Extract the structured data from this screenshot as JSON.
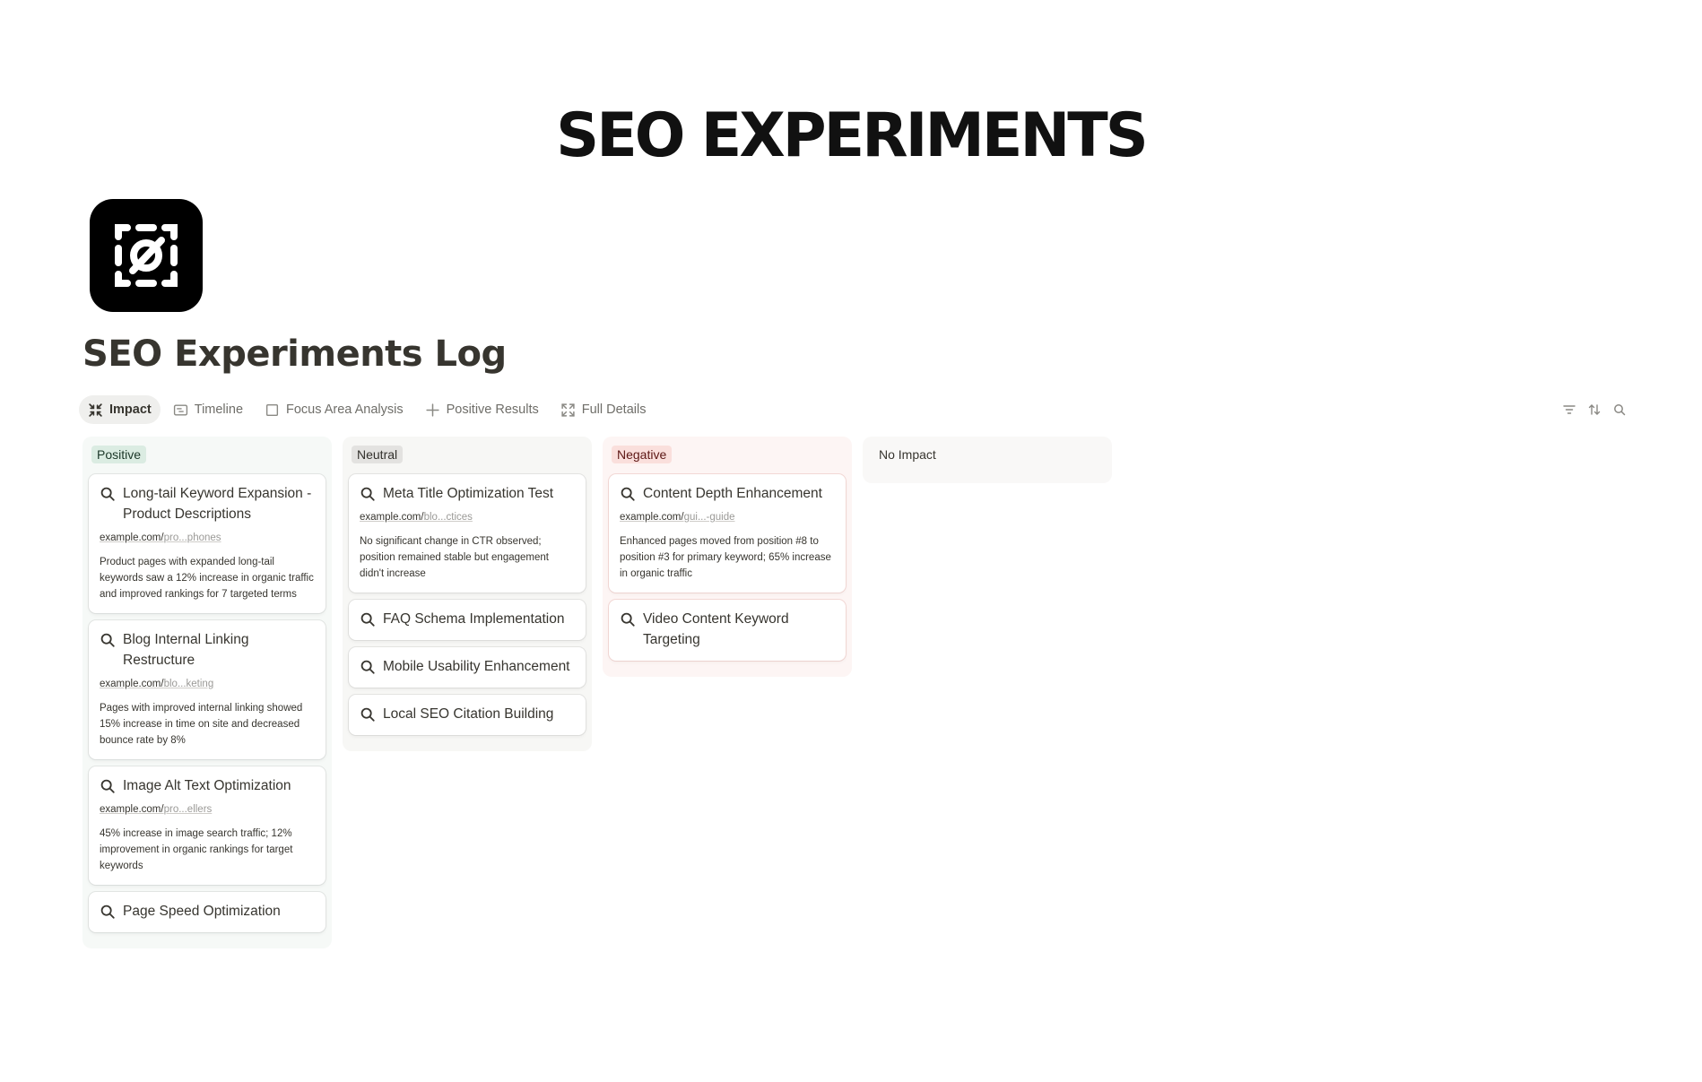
{
  "banner": {
    "title": "SEO EXPERIMENTS"
  },
  "page": {
    "title": "SEO Experiments Log"
  },
  "tabs": [
    {
      "label": "Impact",
      "icon": "board-icon"
    },
    {
      "label": "Timeline",
      "icon": "timeline-icon"
    },
    {
      "label": "Focus Area Analysis",
      "icon": "gallery-icon"
    },
    {
      "label": "Positive Results",
      "icon": "plus-icon"
    },
    {
      "label": "Full Details",
      "icon": "expand-icon"
    }
  ],
  "toolbar": {
    "icons": [
      "filter-icon",
      "sort-icon",
      "search-icon"
    ]
  },
  "columns": {
    "positive": {
      "label": "Positive",
      "cards": [
        {
          "title": "Long-tail Keyword Expansion - Product Descriptions",
          "url_host": "example.com/",
          "url_rest": "pro...phones",
          "desc": "Product pages with expanded long-tail keywords saw a 12% increase in organic traffic and improved rankings for 7 targeted terms"
        },
        {
          "title": "Blog Internal Linking Restructure",
          "url_host": "example.com/",
          "url_rest": "blo...keting",
          "desc": "Pages with improved internal linking showed 15% increase in time on site and decreased bounce rate by 8%"
        },
        {
          "title": "Image Alt Text Optimization",
          "url_host": "example.com/",
          "url_rest": "pro...ellers",
          "desc": "45% increase in image search traffic; 12% improvement in organic rankings for target keywords"
        },
        {
          "title": "Page Speed Optimization"
        }
      ]
    },
    "neutral": {
      "label": "Neutral",
      "cards": [
        {
          "title": "Meta Title Optimization Test",
          "url_host": "example.com/",
          "url_rest": "blo...ctices",
          "desc": "No significant change in CTR observed; position remained stable but engagement didn't increase"
        },
        {
          "title": "FAQ Schema Implementation"
        },
        {
          "title": "Mobile Usability Enhancement"
        },
        {
          "title": "Local SEO Citation Building"
        }
      ]
    },
    "negative": {
      "label": "Negative",
      "cards": [
        {
          "title": "Content Depth Enhancement",
          "url_host": "example.com/",
          "url_rest": "gui...-guide",
          "desc": "Enhanced pages moved from position #8 to position #3 for primary keyword; 65% increase in organic traffic"
        },
        {
          "title": "Video Content Keyword Targeting"
        }
      ]
    },
    "noimpact": {
      "label": "No Impact"
    }
  },
  "colors": {
    "positive_bg": "#dbece2",
    "neutral_bg": "#e3e2e0",
    "negative_bg": "#fadfdc",
    "text": "#37352f"
  }
}
